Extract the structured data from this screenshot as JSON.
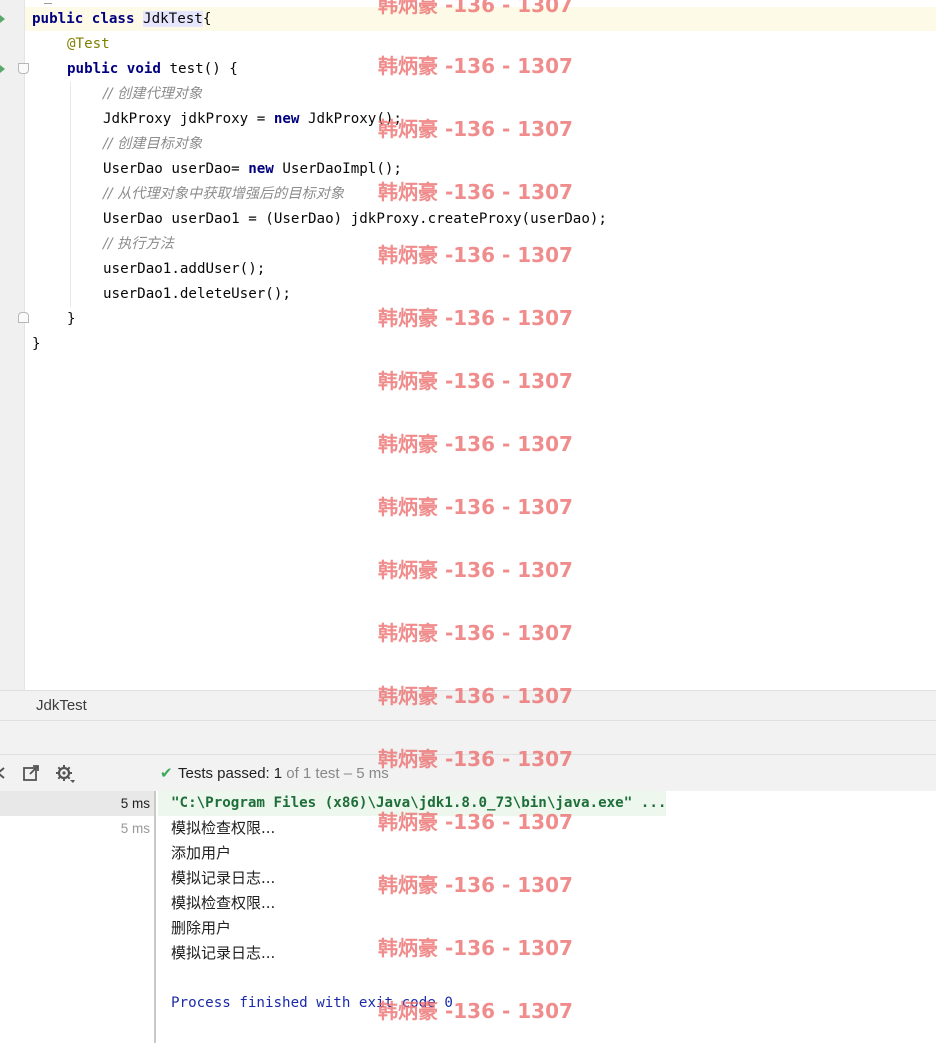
{
  "editor": {
    "lines": {
      "class_kw": "public class ",
      "class_name": "JdkTest",
      "class_open": "{",
      "annotation": "@Test",
      "method_kw": "public void ",
      "method_sig": "test() {",
      "c1": "// 创建代理对象",
      "l5": "JdkProxy jdkProxy = ",
      "new1": "new",
      "l5b": " JdkProxy();",
      "c2": "// 创建目标对象",
      "l7": "UserDao userDao= ",
      "new2": "new",
      "l7b": " UserDaoImpl();",
      "c3": "// 从代理对象中获取增强后的目标对象",
      "l9": "UserDao userDao1 = (UserDao) jdkProxy.createProxy(userDao);",
      "c4": "// 执行方法",
      "l11": "userDao1.addUser();",
      "l12": "userDao1.deleteUser();",
      "close_method": "}",
      "close_class": "}"
    }
  },
  "tool_window": {
    "title": "JdkTest",
    "status": {
      "label": "Tests passed:",
      "passed": "1",
      "detail": "of 1 test – 5 ms"
    },
    "tree": [
      {
        "time": "5 ms",
        "selected": true
      },
      {
        "time": "5 ms",
        "selected": false
      }
    ],
    "console": {
      "command": "\"C:\\Program Files (x86)\\Java\\jdk1.8.0_73\\bin\\java.exe\" ...",
      "output": [
        "模拟检查权限...",
        "添加用户",
        "模拟记录日志...",
        "模拟检查权限...",
        "删除用户",
        "模拟记录日志..."
      ],
      "blank": "",
      "exit": "Process finished with exit code 0"
    },
    "toolbar_icons": [
      "collapse-icon",
      "export-icon",
      "settings-icon"
    ]
  },
  "watermark": {
    "text": "韩炳豪 -136 - 1307"
  },
  "colors": {
    "keyword": "#000080",
    "annotation": "#808000",
    "comment": "#8c8c8c",
    "pass_green": "#3aa95a",
    "watermark": "#ec6c6c"
  }
}
